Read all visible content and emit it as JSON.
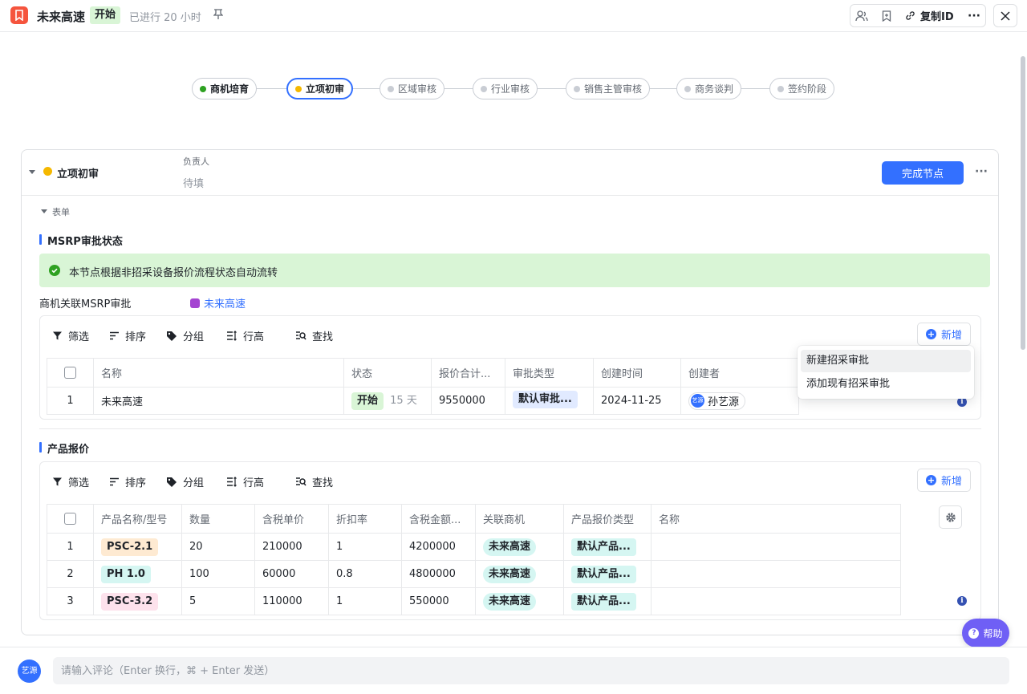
{
  "header": {
    "title": "未来高速",
    "status_badge": "开始",
    "elapsed": "已进行 20 小时",
    "pin_icon": "pin-icon",
    "copy_id_label": "复制ID",
    "close_icon": "close-icon"
  },
  "stages": [
    {
      "label": "商机培育",
      "state": "done"
    },
    {
      "label": "立项初审",
      "state": "active"
    },
    {
      "label": "区域审核",
      "state": "pending"
    },
    {
      "label": "行业审核",
      "state": "pending"
    },
    {
      "label": "销售主管审核",
      "state": "pending"
    },
    {
      "label": "商务谈判",
      "state": "pending"
    },
    {
      "label": "签约阶段",
      "state": "pending"
    }
  ],
  "node": {
    "name": "立项初审",
    "owner_label": "负责人",
    "owner_value": "待填",
    "complete_button": "完成节点",
    "form_label": "表单"
  },
  "msrp": {
    "section_title": "MSRP审批状态",
    "alert_text": "本节点根据非招采设备报价流程状态自动流转",
    "link_label": "商机关联MSRP审批",
    "link_value": "未来高速",
    "toolbar": {
      "filter": "筛选",
      "sort": "排序",
      "group": "分组",
      "row_height": "行高",
      "search": "查找",
      "add": "新增"
    },
    "columns": [
      "名称",
      "状态",
      "报价合计...",
      "审批类型",
      "创建时间",
      "创建者"
    ],
    "rows": [
      {
        "index": "1",
        "name": "未来高速",
        "status": "开始",
        "duration": "15 天",
        "total": "9550000",
        "approval_type": "默认审批...",
        "created": "2024-11-25",
        "creator": "孙艺源",
        "creator_avatar": "艺源"
      }
    ],
    "add_menu": [
      "新建招采审批",
      "添加现有招采审批"
    ]
  },
  "quote": {
    "section_title": "产品报价",
    "toolbar": {
      "filter": "筛选",
      "sort": "排序",
      "group": "分组",
      "row_height": "行高",
      "search": "查找",
      "add": "新增"
    },
    "columns": [
      "产品名称/型号",
      "数量",
      "含税单价",
      "折扣率",
      "含税金额...",
      "关联商机",
      "产品报价类型",
      "名称"
    ],
    "rows": [
      {
        "index": "1",
        "model": "PSC-2.1",
        "qty": "20",
        "unit_price": "210000",
        "discount": "1",
        "amount": "4200000",
        "opportunity": "未来高速",
        "quote_type": "默认产品...",
        "name": ""
      },
      {
        "index": "2",
        "model": "PH 1.0",
        "qty": "100",
        "unit_price": "60000",
        "discount": "0.8",
        "amount": "4800000",
        "opportunity": "未来高速",
        "quote_type": "默认产品...",
        "name": ""
      },
      {
        "index": "3",
        "model": "PSC-3.2",
        "qty": "5",
        "unit_price": "110000",
        "discount": "1",
        "amount": "550000",
        "opportunity": "未来高速",
        "quote_type": "默认产品...",
        "name": ""
      }
    ]
  },
  "comment": {
    "avatar_text": "艺源",
    "placeholder": "请输入评论（Enter 换行，⌘ + Enter 发送）"
  },
  "help": {
    "label": "帮助"
  },
  "colors": {
    "primary": "#3370ff",
    "success": "#2ea121",
    "active_dot": "#f5b800",
    "brand_icon": "#f5543d",
    "help": "#6f5ff5"
  }
}
